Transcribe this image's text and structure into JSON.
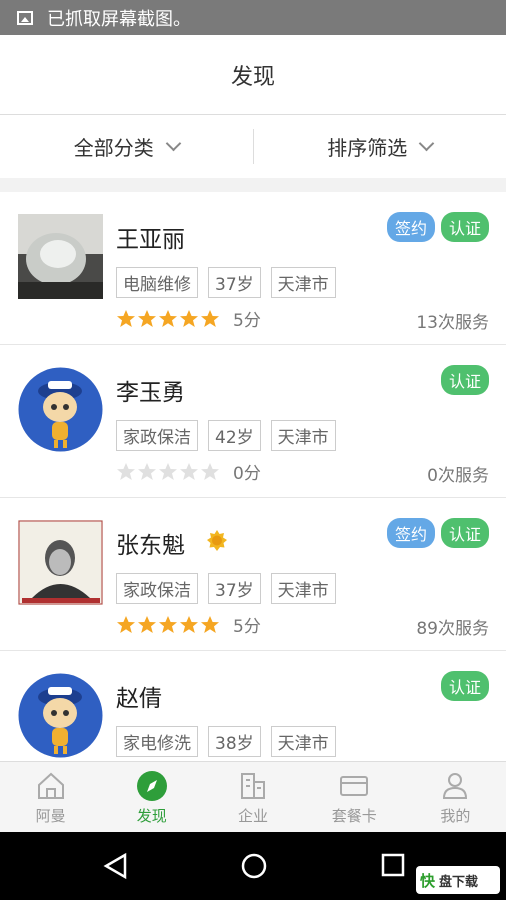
{
  "status_bar": {
    "text": "已抓取屏幕截图。"
  },
  "header": {
    "title": "发现"
  },
  "filters": {
    "category": "全部分类",
    "sort": "排序筛选"
  },
  "badge_labels": {
    "sign": "签约",
    "cert": "认证"
  },
  "cards": [
    {
      "name": "王亚丽",
      "signed": true,
      "certified": true,
      "tags": [
        "电脑维修",
        "37岁",
        "天津市"
      ],
      "rating": 5,
      "score": "5分",
      "services": "13次服务",
      "avatar": "photo-earphones",
      "medal": false
    },
    {
      "name": "李玉勇",
      "signed": false,
      "certified": true,
      "tags": [
        "家政保洁",
        "42岁",
        "天津市"
      ],
      "rating": 0,
      "score": "0分",
      "services": "0次服务",
      "avatar": "cartoon-mascot",
      "medal": false
    },
    {
      "name": "张东魁",
      "signed": true,
      "certified": true,
      "tags": [
        "家政保洁",
        "37岁",
        "天津市"
      ],
      "rating": 5,
      "score": "5分",
      "services": "89次服务",
      "avatar": "photo-portrait",
      "medal": true
    },
    {
      "name": "赵倩",
      "signed": false,
      "certified": true,
      "tags": [
        "家电修洗",
        "38岁",
        "天津市"
      ],
      "rating": 0,
      "score": "",
      "services": "",
      "avatar": "cartoon-mascot",
      "medal": false
    }
  ],
  "tabs": [
    {
      "label": "阿曼",
      "icon": "home-icon",
      "active": false
    },
    {
      "label": "发现",
      "icon": "compass-icon",
      "active": true
    },
    {
      "label": "企业",
      "icon": "building-icon",
      "active": false
    },
    {
      "label": "套餐卡",
      "icon": "card-icon",
      "active": false
    },
    {
      "label": "我的",
      "icon": "user-icon",
      "active": false
    }
  ],
  "watermark": {
    "logo": "快",
    "text": "盘下载"
  },
  "colors": {
    "accent": "#2e9e3a",
    "sign_badge": "#64a8e6",
    "cert_badge": "#4fc06e",
    "star": "#f5a623",
    "star_empty": "#e0e0e0"
  }
}
